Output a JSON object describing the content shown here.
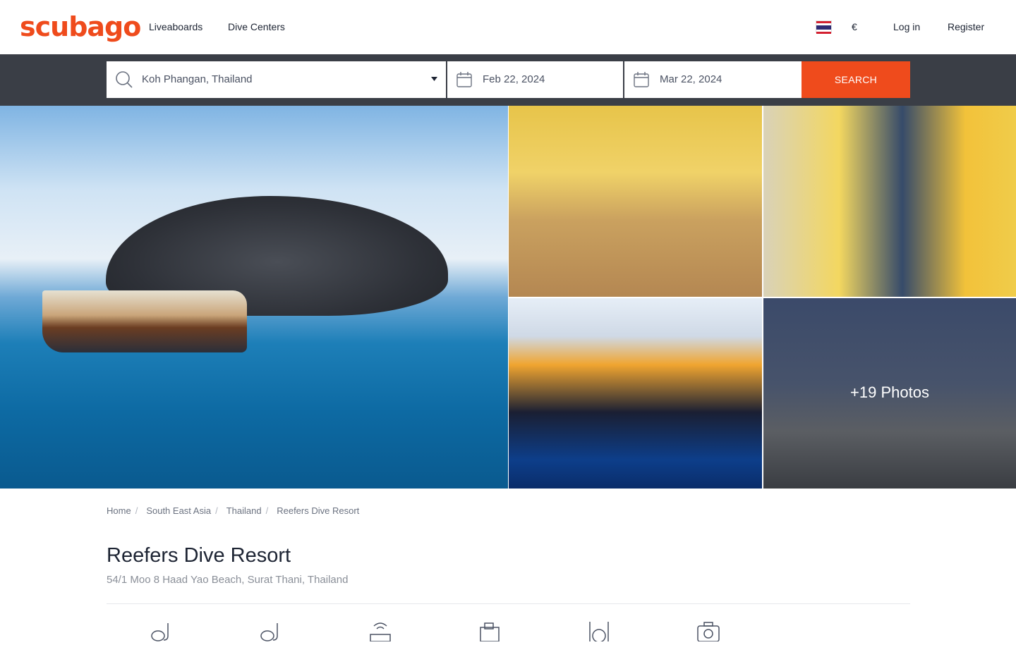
{
  "header": {
    "logo": "scubago",
    "nav": [
      {
        "label": "Liveaboards"
      },
      {
        "label": "Dive Centers"
      }
    ],
    "currency": "€",
    "login": "Log in",
    "register": "Register",
    "flag_icon": "thailand-flag-icon"
  },
  "search": {
    "location": "Koh Phangan, Thailand",
    "date_from": "Feb 22, 2024",
    "date_to": "Mar 22, 2024",
    "button": "SEARCH"
  },
  "gallery": {
    "more_photos": "+19 Photos"
  },
  "breadcrumb": [
    {
      "label": "Home"
    },
    {
      "label": "South East Asia"
    },
    {
      "label": "Thailand"
    },
    {
      "label": "Reefers Dive Resort"
    }
  ],
  "resort": {
    "name": "Reefers Dive Resort",
    "address": "54/1 Moo 8 Haad Yao Beach, Surat Thani, Thailand"
  },
  "amenities": [
    {
      "icon": "snorkel-mask-icon"
    },
    {
      "icon": "snorkel-mask-icon"
    },
    {
      "icon": "wifi-router-icon"
    },
    {
      "icon": "building-icon"
    },
    {
      "icon": "restaurant-icon"
    },
    {
      "icon": "camera-icon"
    }
  ],
  "colors": {
    "brand": "#ef4b1c",
    "search_band": "#3a3e46",
    "text": "#1d2433"
  }
}
